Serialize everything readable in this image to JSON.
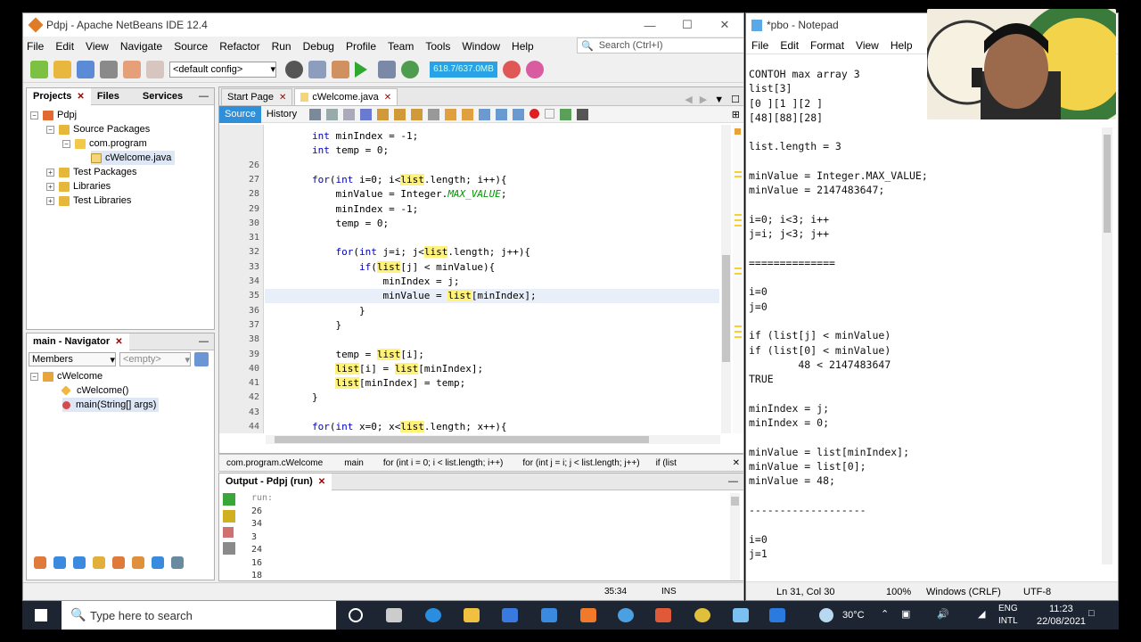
{
  "netbeans": {
    "title": "Pdpj - Apache NetBeans IDE 12.4",
    "menu": [
      "File",
      "Edit",
      "View",
      "Navigate",
      "Source",
      "Refactor",
      "Run",
      "Debug",
      "Profile",
      "Team",
      "Tools",
      "Window",
      "Help"
    ],
    "search_placeholder": "Search (Ctrl+I)",
    "config": "<default config>",
    "memory": "618.7/637.0MB",
    "project_tabs": [
      "Projects",
      "Files",
      "Services"
    ],
    "tree": [
      {
        "label": "Pdpj"
      },
      {
        "label": "Source Packages"
      },
      {
        "label": "com.program"
      },
      {
        "label": "cWelcome.java"
      },
      {
        "label": "Test Packages"
      },
      {
        "label": "Libraries"
      },
      {
        "label": "Test Libraries"
      }
    ],
    "navigator": {
      "title": "main - Navigator",
      "members": "Members",
      "filter": "<empty>",
      "items": [
        "cWelcome",
        "cWelcome()",
        "main(String[] args)"
      ]
    },
    "editor_tabs": [
      "Start Page",
      "cWelcome.java"
    ],
    "subtabs": [
      "Source",
      "History"
    ],
    "code_lines": [
      {
        "n": "",
        "t": "        int minIndex = -1;"
      },
      {
        "n": "",
        "t": "        int temp = 0;"
      },
      {
        "n": "26",
        "t": ""
      },
      {
        "n": "27",
        "t": "        for(int i=0; i<list.length; i++){"
      },
      {
        "n": "28",
        "t": "            minValue = Integer.MAX_VALUE;"
      },
      {
        "n": "29",
        "t": "            minIndex = -1;"
      },
      {
        "n": "30",
        "t": "            temp = 0;"
      },
      {
        "n": "31",
        "t": ""
      },
      {
        "n": "32",
        "t": "            for(int j=i; j<list.length; j++){"
      },
      {
        "n": "33",
        "t": "                if(list[j] < minValue){"
      },
      {
        "n": "34",
        "t": "                    minIndex = j;"
      },
      {
        "n": "35",
        "t": "                    minValue = list[minIndex];"
      },
      {
        "n": "36",
        "t": "                }"
      },
      {
        "n": "37",
        "t": "            }"
      },
      {
        "n": "38",
        "t": ""
      },
      {
        "n": "39",
        "t": "            temp = list[i];"
      },
      {
        "n": "40",
        "t": "            list[i] = list[minIndex];"
      },
      {
        "n": "41",
        "t": "            list[minIndex] = temp;"
      },
      {
        "n": "42",
        "t": "        }"
      },
      {
        "n": "43",
        "t": ""
      },
      {
        "n": "44",
        "t": "        for(int x=0; x<list.length; x++){"
      }
    ],
    "breadcrumbs": [
      "com.program.cWelcome",
      "main",
      "for (int i = 0; i < list.length; i++)",
      "for (int j = i; j < list.length; j++)",
      "if (list"
    ],
    "output_title": "Output - Pdpj (run)",
    "output_lines": [
      "run:",
      "26",
      "34",
      "3",
      "24",
      "16",
      "18"
    ],
    "status_pos": "35:34",
    "status_mode": "INS"
  },
  "notepad": {
    "title": "*pbo - Notepad",
    "menu": [
      "File",
      "Edit",
      "Format",
      "View",
      "Help"
    ],
    "text": "CONTOH max array 3\nlist[3]\n[0 ][1 ][2 ]\n[48][88][28]\n\nlist.length = 3\n\nminValue = Integer.MAX_VALUE;\nminValue = 2147483647;\n\ni=0; i<3; i++\nj=i; j<3; j++\n\n==============\n\ni=0\nj=0\n\nif (list[j] < minValue)\nif (list[0] < minValue)\n        48 < 2147483647\nTRUE\n\nminIndex = j;\nminIndex = 0;\n\nminValue = list[minIndex];\nminValue = list[0];\nminValue = 48;\n\n-------------------\n\ni=0\nj=1",
    "status": {
      "pos": "Ln 31, Col 30",
      "zoom": "100%",
      "eol": "Windows (CRLF)",
      "enc": "UTF-8"
    }
  },
  "taskbar": {
    "search": "Type here to search",
    "weather": "30°C",
    "lang": "ENG",
    "lang2": "INTL",
    "time": "11:23",
    "date": "22/08/2021"
  }
}
